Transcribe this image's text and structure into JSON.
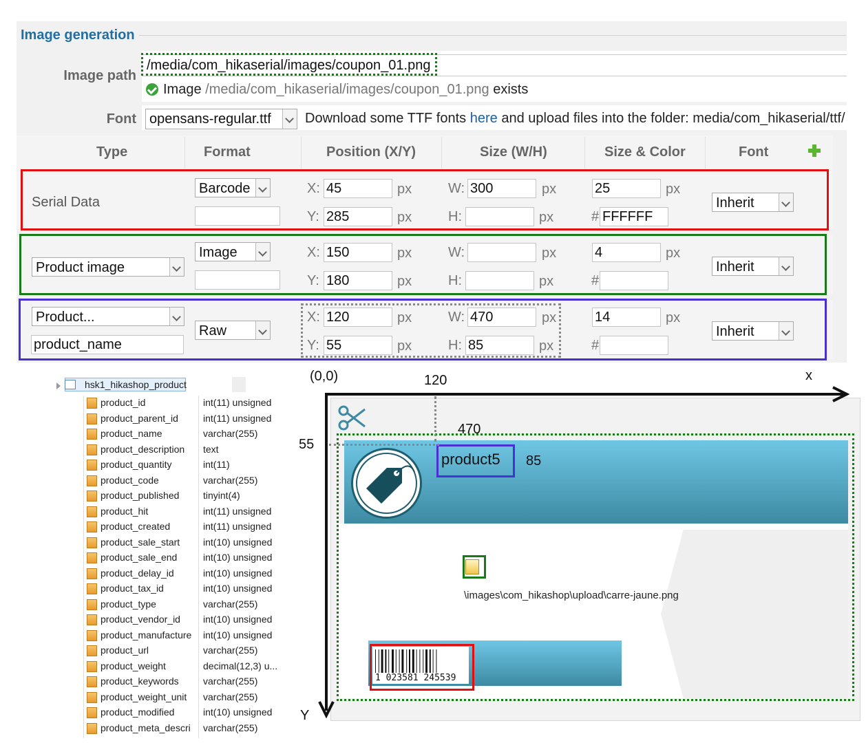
{
  "image_generation": {
    "legend": "Image generation",
    "image_path_label": "Image path",
    "image_path_value": "/media/com_hikaserial/images/coupon_01.png",
    "status_prefix": "Image",
    "status_path": "/media/com_hikaserial/images/coupon_01.png",
    "status_suffix": "exists",
    "font_label": "Font",
    "font_value": "opensans-regular.ttf",
    "download_prefix": "Download some TTF fonts",
    "download_link": "here",
    "download_suffix": "and upload files into the folder: media/com_hikaserial/ttf/"
  },
  "table": {
    "headers": [
      "Type",
      "Format",
      "Position (X/Y)",
      "Size (W/H)",
      "Size & Color",
      "Font"
    ],
    "x_label": "X:",
    "y_label": "Y:",
    "w_label": "W:",
    "h_label": "H:",
    "px": "px",
    "hash": "#",
    "rows": [
      {
        "type": "Serial Data",
        "format": "Barcode",
        "format_extra": "",
        "x": "45",
        "y": "285",
        "w": "300",
        "h": "",
        "size": "25",
        "color": "FFFFFF",
        "font": "Inherit"
      },
      {
        "type": "Product image",
        "format": "Image",
        "format_extra": "",
        "x": "150",
        "y": "180",
        "w": "",
        "h": "",
        "size": "4",
        "color": "",
        "font": "Inherit"
      },
      {
        "type": "Product...",
        "type_field": "product_name",
        "format": "Raw",
        "x": "120",
        "y": "55",
        "w": "470",
        "h": "85",
        "size": "14",
        "color": "",
        "font": "Inherit"
      }
    ]
  },
  "db_table": {
    "name": "hsk1_hikashop_product",
    "columns": [
      {
        "name": "product_id",
        "type": "int(11) unsigned"
      },
      {
        "name": "product_parent_id",
        "type": "int(11) unsigned"
      },
      {
        "name": "product_name",
        "type": "varchar(255)"
      },
      {
        "name": "product_description",
        "type": "text"
      },
      {
        "name": "product_quantity",
        "type": "int(11)"
      },
      {
        "name": "product_code",
        "type": "varchar(255)"
      },
      {
        "name": "product_published",
        "type": "tinyint(4)"
      },
      {
        "name": "product_hit",
        "type": "int(11) unsigned"
      },
      {
        "name": "product_created",
        "type": "int(11) unsigned"
      },
      {
        "name": "product_sale_start",
        "type": "int(10) unsigned"
      },
      {
        "name": "product_sale_end",
        "type": "int(10) unsigned"
      },
      {
        "name": "product_delay_id",
        "type": "int(10) unsigned"
      },
      {
        "name": "product_tax_id",
        "type": "int(10) unsigned"
      },
      {
        "name": "product_type",
        "type": "varchar(255)"
      },
      {
        "name": "product_vendor_id",
        "type": "int(10) unsigned"
      },
      {
        "name": "product_manufacture",
        "type": "int(10) unsigned"
      },
      {
        "name": "product_url",
        "type": "varchar(255)"
      },
      {
        "name": "product_weight",
        "type": "decimal(12,3) u..."
      },
      {
        "name": "product_keywords",
        "type": "varchar(255)"
      },
      {
        "name": "product_weight_unit",
        "type": "varchar(255)"
      },
      {
        "name": "product_modified",
        "type": "int(10) unsigned"
      },
      {
        "name": "product_meta_descri",
        "type": "varchar(255)"
      }
    ]
  },
  "diagram": {
    "origin": "(0,0)",
    "x_axis": "x",
    "y_axis": "Y",
    "dim_x": "120",
    "dim_w": "470",
    "dim_y": "55",
    "dim_h": "85",
    "product_text": "product5",
    "image_path": "\\images\\com_hikashop\\upload\\carre-jaune.png",
    "barcode_digits": "1 023581 245539"
  },
  "colors": {
    "red_frame": "#e01010",
    "green_frame": "#1a7a1a",
    "blue_frame": "#4a2fd6",
    "accent_link": "#1a5fa8"
  }
}
